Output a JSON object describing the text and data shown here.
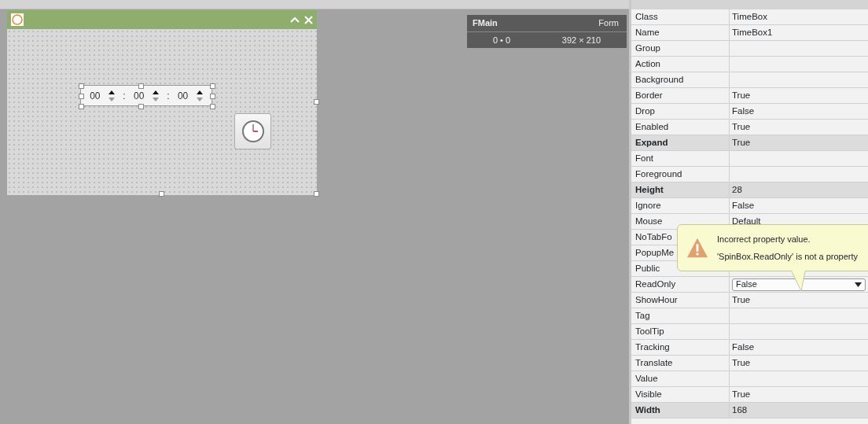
{
  "form": {
    "timebox": {
      "fields": [
        "00",
        "00",
        "00"
      ],
      "separators": [
        ":",
        ":"
      ]
    }
  },
  "info_panel": {
    "name": "FMain",
    "type": "Form",
    "position": "0 • 0",
    "size": "392 × 210"
  },
  "properties": [
    {
      "name": "Class",
      "value": "TimeBox",
      "modified": false
    },
    {
      "name": "Name",
      "value": "TimeBox1",
      "modified": false
    },
    {
      "name": "Group",
      "modified": false
    },
    {
      "name": "Action",
      "modified": false
    },
    {
      "name": "Background",
      "modified": false
    },
    {
      "name": "Border",
      "value": "True",
      "modified": false
    },
    {
      "name": "Drop",
      "value": "False",
      "modified": false
    },
    {
      "name": "Enabled",
      "value": "True",
      "modified": false
    },
    {
      "name": "Expand",
      "value": "True",
      "modified": true
    },
    {
      "name": "Font",
      "modified": false
    },
    {
      "name": "Foreground",
      "modified": false
    },
    {
      "name": "Height",
      "value": "28",
      "modified": true
    },
    {
      "name": "Ignore",
      "value": "False",
      "modified": false
    },
    {
      "name": "Mouse",
      "value": "Default",
      "modified": false
    },
    {
      "name": "NoTabFo",
      "modified": false
    },
    {
      "name": "PopupMe",
      "modified": false
    },
    {
      "name": "Public",
      "modified": false
    },
    {
      "name": "ReadOnly",
      "value": "False",
      "modified": false,
      "kind": "dropdown"
    },
    {
      "name": "ShowHour",
      "value": "True",
      "modified": false
    },
    {
      "name": "Tag",
      "modified": false
    },
    {
      "name": "ToolTip",
      "modified": false
    },
    {
      "name": "Tracking",
      "value": "False",
      "modified": false
    },
    {
      "name": "Translate",
      "value": "True",
      "modified": false
    },
    {
      "name": "Value",
      "modified": false
    },
    {
      "name": "Visible",
      "value": "True",
      "modified": false
    },
    {
      "name": "Width",
      "value": "168",
      "modified": true
    }
  ],
  "tooltip": {
    "title": "Incorrect property value.",
    "message": "'SpinBox.ReadOnly' is not a property"
  }
}
